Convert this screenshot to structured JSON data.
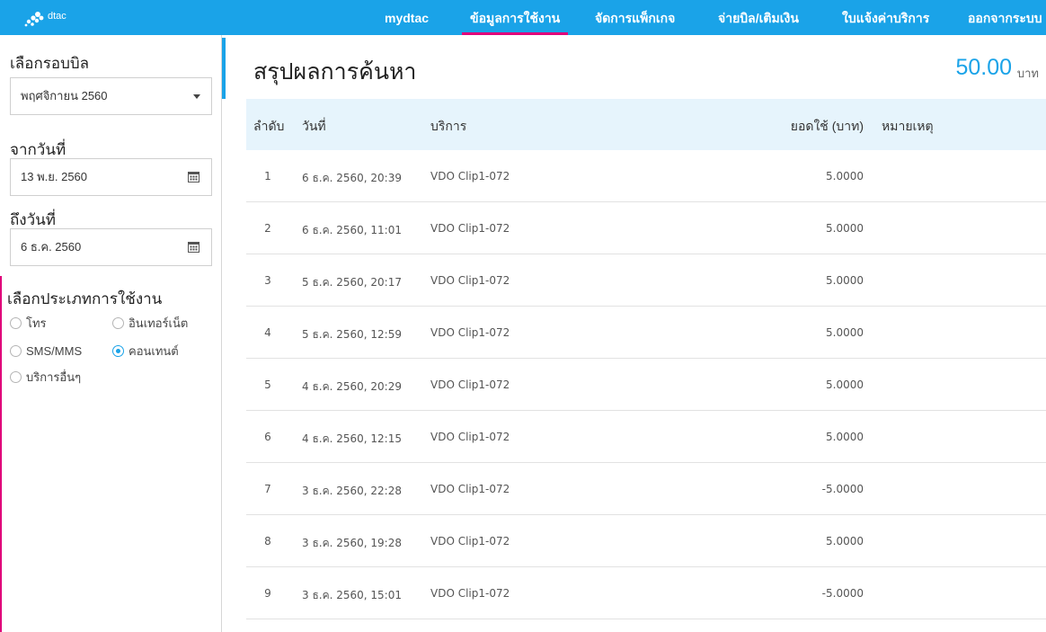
{
  "header": {
    "logo_text": "dtac",
    "nav": [
      {
        "label": "mydtac",
        "active": false
      },
      {
        "label": "ข้อมูลการใช้งาน",
        "active": true
      },
      {
        "label": "จัดการแพ็กเกจ",
        "active": false
      },
      {
        "label": "จ่ายบิล/เติมเงิน",
        "active": false
      },
      {
        "label": "ใบแจ้งค่าบริการ",
        "active": false
      },
      {
        "label": "ออกจากระบบ",
        "active": false
      }
    ]
  },
  "sidebar": {
    "bill_cycle_label": "เลือกรอบบิล",
    "bill_cycle_value": "พฤศจิกายน 2560",
    "from_date_label": "จากวันที่",
    "from_date_value": "13 พ.ย. 2560",
    "to_date_label": "ถึงวันที่",
    "to_date_value": "6 ธ.ค. 2560",
    "usage_type_label": "เลือกประเภทการใช้งาน",
    "usage_types": [
      {
        "label": "โทร",
        "checked": false
      },
      {
        "label": "อินเทอร์เน็ต",
        "checked": false
      },
      {
        "label": "SMS/MMS",
        "checked": false
      },
      {
        "label": "คอนเทนต์",
        "checked": true
      },
      {
        "label": "บริการอื่นๆ",
        "checked": false
      }
    ]
  },
  "main": {
    "title": "สรุปผลการค้นหา",
    "total_amount": "50.00",
    "total_unit": "บาท",
    "columns": {
      "no": "ลำดับ",
      "date": "วันที่",
      "service": "บริการ",
      "amount": "ยอดใช้ (บาท)",
      "note": "หมายเหตุ"
    },
    "rows": [
      {
        "no": "1",
        "date": "6 ธ.ค. 2560, 20:39",
        "service": "VDO Clip1-072",
        "amount": "5.0000",
        "note": ""
      },
      {
        "no": "2",
        "date": "6 ธ.ค. 2560, 11:01",
        "service": "VDO Clip1-072",
        "amount": "5.0000",
        "note": ""
      },
      {
        "no": "3",
        "date": "5 ธ.ค. 2560, 20:17",
        "service": "VDO Clip1-072",
        "amount": "5.0000",
        "note": ""
      },
      {
        "no": "4",
        "date": "5 ธ.ค. 2560, 12:59",
        "service": "VDO Clip1-072",
        "amount": "5.0000",
        "note": ""
      },
      {
        "no": "5",
        "date": "4 ธ.ค. 2560, 20:29",
        "service": "VDO Clip1-072",
        "amount": "5.0000",
        "note": ""
      },
      {
        "no": "6",
        "date": "4 ธ.ค. 2560, 12:15",
        "service": "VDO Clip1-072",
        "amount": "5.0000",
        "note": ""
      },
      {
        "no": "7",
        "date": "3 ธ.ค. 2560, 22:28",
        "service": "VDO Clip1-072",
        "amount": "-5.0000",
        "note": ""
      },
      {
        "no": "8",
        "date": "3 ธ.ค. 2560, 19:28",
        "service": "VDO Clip1-072",
        "amount": "5.0000",
        "note": ""
      },
      {
        "no": "9",
        "date": "3 ธ.ค. 2560, 15:01",
        "service": "VDO Clip1-072",
        "amount": "-5.0000",
        "note": ""
      }
    ]
  },
  "colors": {
    "brand_blue": "#1aa3e8",
    "accent_magenta": "#e0007a",
    "table_header_bg": "#e6f4fc"
  }
}
